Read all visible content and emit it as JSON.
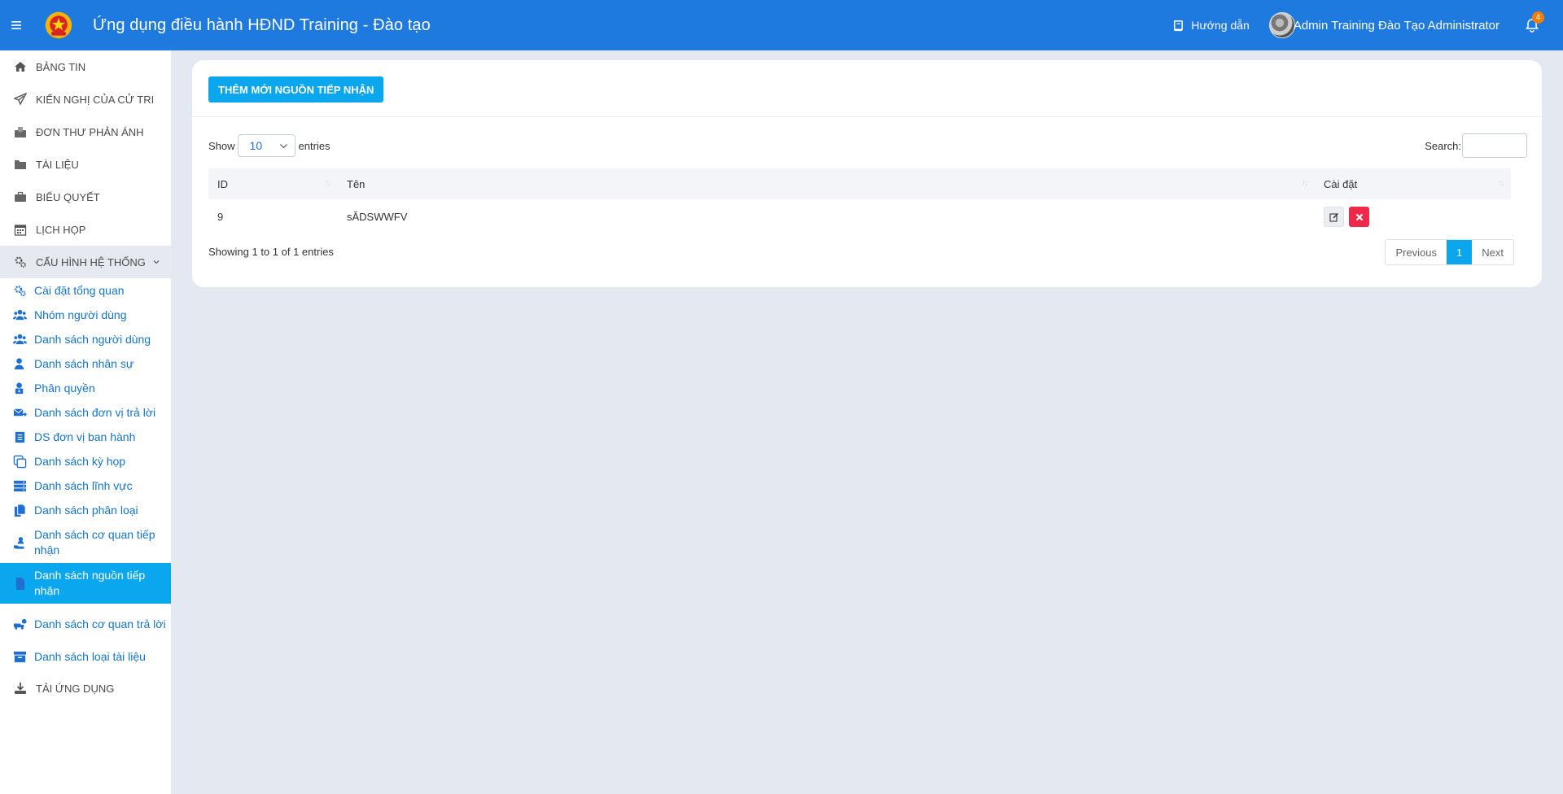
{
  "header": {
    "title": "Ứng dụng điều hành HĐND Training - Đào tạo",
    "guide_label": "Hướng dẫn",
    "user_name": "Admin Training Đào Tạo Administrator",
    "notification_count": "4"
  },
  "sidebar": {
    "items": [
      {
        "label": "BẢNG TIN",
        "icon": "home-icon"
      },
      {
        "label": "KIẾN NGHỊ CỦA CỬ TRI",
        "icon": "paper-plane-icon"
      },
      {
        "label": "ĐƠN THƯ PHẢN ÁNH",
        "icon": "inbox-icon"
      },
      {
        "label": "TÀI LIỆU",
        "icon": "folder-icon"
      },
      {
        "label": "BIỂU QUYẾT",
        "icon": "briefcase-icon"
      },
      {
        "label": "LỊCH HỌP",
        "icon": "calendar-icon"
      }
    ],
    "group": {
      "label": "CẤU HÌNH HỆ THỐNG",
      "icon": "gears-icon"
    },
    "sub_items": [
      {
        "label": "Cài đặt tổng quan"
      },
      {
        "label": "Nhóm người dùng"
      },
      {
        "label": "Danh sách người dùng"
      },
      {
        "label": "Danh sách nhân sự"
      },
      {
        "label": "Phân quyền"
      },
      {
        "label": "Danh sách đơn vị trả lời"
      },
      {
        "label": "DS đơn vị ban hành"
      },
      {
        "label": "Danh sách kỳ họp"
      },
      {
        "label": "Danh sách lĩnh vực"
      },
      {
        "label": "Danh sách phân loại"
      },
      {
        "label": "Danh sách cơ quan tiếp nhận"
      },
      {
        "label": "Danh sách nguồn tiếp nhận"
      },
      {
        "label": "Danh sách cơ quan trả lời"
      },
      {
        "label": "Danh sách loại tài liệu"
      }
    ],
    "download": {
      "label": "TẢI ỨNG DỤNG"
    }
  },
  "main": {
    "add_button": "THÊM MỚI NGUỒN TIẾP NHẬN",
    "show_label": "Show",
    "entries_value": "10",
    "entries_label": "entries",
    "search_label": "Search:",
    "table": {
      "headers": [
        "ID",
        "Tên",
        "Cài đặt"
      ],
      "rows": [
        {
          "id": "9",
          "name": "sĂDSWWFV"
        }
      ]
    },
    "info": "Showing 1 to 1 of 1 entries",
    "pager": {
      "previous": "Previous",
      "current": "1",
      "next": "Next"
    }
  },
  "colors": {
    "header": "#1f7ae0",
    "accent": "#0aa6ee",
    "danger": "#f0284a",
    "link": "#1674c8"
  }
}
